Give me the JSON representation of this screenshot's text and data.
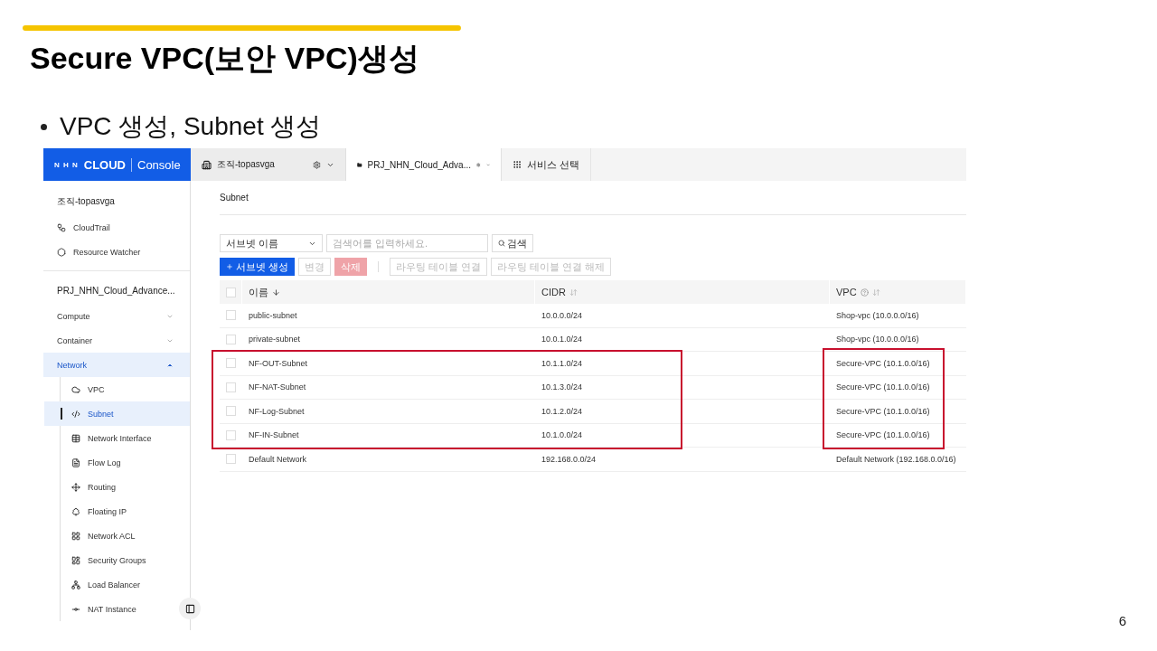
{
  "slide": {
    "title": "Secure VPC(보안 VPC)생성",
    "bullets": [
      "VPC 생성, Subnet 생성"
    ],
    "page_number": "6"
  },
  "console": {
    "header": {
      "logo": {
        "mark": "N H N",
        "brand": "CLOUD",
        "product": "Console"
      },
      "tabs": [
        {
          "label": "조직-topasvga",
          "selected": false
        },
        {
          "label": "PRJ_NHN_Cloud_Adva...",
          "selected": true
        }
      ],
      "service_button": "서비스 선택"
    },
    "sidebar": {
      "org": "조직-topasvga",
      "org_items": [
        {
          "label": "CloudTrail"
        },
        {
          "label": "Resource Watcher"
        }
      ],
      "project": "PRJ_NHN_Cloud_Advance...",
      "sections": [
        {
          "label": "Compute",
          "expanded": false,
          "selected": false
        },
        {
          "label": "Container",
          "expanded": false,
          "selected": false
        },
        {
          "label": "Network",
          "expanded": true,
          "selected": true,
          "children": [
            {
              "label": "VPC",
              "selected": false
            },
            {
              "label": "Subnet",
              "selected": true
            },
            {
              "label": "Network Interface",
              "selected": false
            },
            {
              "label": "Flow Log",
              "selected": false
            },
            {
              "label": "Routing",
              "selected": false
            },
            {
              "label": "Floating IP",
              "selected": false
            },
            {
              "label": "Network ACL",
              "selected": false
            },
            {
              "label": "Security Groups",
              "selected": false
            },
            {
              "label": "Load Balancer",
              "selected": false
            },
            {
              "label": "NAT Instance",
              "selected": false
            }
          ]
        }
      ]
    },
    "main": {
      "title": "Subnet",
      "filter": {
        "select": "서브넷 이름",
        "placeholder": "검색어를 입력하세요.",
        "search_button": "검색"
      },
      "actions": [
        {
          "label": "서브넷 생성",
          "kind": "primary",
          "disabled": false
        },
        {
          "label": "변경",
          "kind": "default",
          "disabled": true
        },
        {
          "label": "삭제",
          "kind": "danger",
          "disabled": true
        },
        {
          "label": "라우팅 테이블 연결",
          "kind": "default",
          "disabled": true
        },
        {
          "label": "라우팅 테이블 연결 해제",
          "kind": "default",
          "disabled": true
        }
      ],
      "table": {
        "header_checked": false,
        "columns": [
          {
            "label": "이름",
            "sorted": true,
            "help": false
          },
          {
            "label": "CIDR",
            "sorted": false,
            "help": false
          },
          {
            "label": "VPC",
            "sorted": false,
            "help": true
          }
        ],
        "rows": [
          {
            "cells": [
              "public-subnet",
              "10.0.0.0/24",
              "Shop-vpc (10.0.0.0/16)"
            ],
            "checked": false,
            "highlighted": false
          },
          {
            "cells": [
              "private-subnet",
              "10.0.1.0/24",
              "Shop-vpc (10.0.0.0/16)"
            ],
            "checked": false,
            "highlighted": false
          },
          {
            "cells": [
              "NF-OUT-Subnet",
              "10.1.1.0/24",
              "Secure-VPC (10.1.0.0/16)"
            ],
            "checked": false,
            "highlighted": true
          },
          {
            "cells": [
              "NF-NAT-Subnet",
              "10.1.3.0/24",
              "Secure-VPC (10.1.0.0/16)"
            ],
            "checked": false,
            "highlighted": true
          },
          {
            "cells": [
              "NF-Log-Subnet",
              "10.1.2.0/24",
              "Secure-VPC (10.1.0.0/16)"
            ],
            "checked": false,
            "highlighted": true
          },
          {
            "cells": [
              "NF-IN-Subnet",
              "10.1.0.0/24",
              "Secure-VPC (10.1.0.0/16)"
            ],
            "checked": false,
            "highlighted": true
          },
          {
            "cells": [
              "Default Network",
              "192.168.0.0/24",
              "Default Network (192.168.0.0/16)"
            ],
            "checked": false,
            "highlighted": false
          }
        ]
      }
    }
  }
}
